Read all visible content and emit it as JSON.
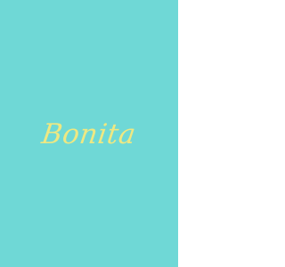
{
  "cover": {
    "title": "Bonita",
    "background_color": "#6fd8d6",
    "title_color": "#eee882"
  }
}
